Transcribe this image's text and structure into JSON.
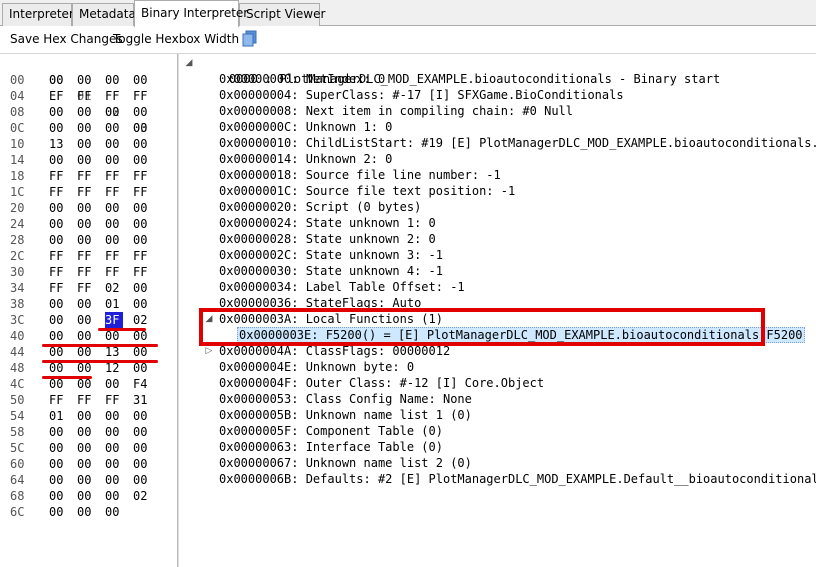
{
  "tabs": [
    "Interpreter",
    "Metadata",
    "Binary Interpreter",
    "Script Viewer"
  ],
  "active_tab": "Binary Interpreter",
  "toolbar": {
    "save_label": "Save Hex Changes",
    "toggle_label": "Toggle Hexbox Width",
    "copy_icon": "copy-icon"
  },
  "hex": {
    "column_headers": [
      "00",
      "01",
      "02",
      "03"
    ],
    "rows": [
      {
        "offset": "00",
        "bytes": [
          "00",
          "00",
          "00",
          "00"
        ]
      },
      {
        "offset": "04",
        "bytes": [
          "EF",
          "FF",
          "FF",
          "FF"
        ]
      },
      {
        "offset": "08",
        "bytes": [
          "00",
          "00",
          "00",
          "00"
        ]
      },
      {
        "offset": "0C",
        "bytes": [
          "00",
          "00",
          "00",
          "00"
        ]
      },
      {
        "offset": "10",
        "bytes": [
          "13",
          "00",
          "00",
          "00"
        ]
      },
      {
        "offset": "14",
        "bytes": [
          "00",
          "00",
          "00",
          "00"
        ]
      },
      {
        "offset": "18",
        "bytes": [
          "FF",
          "FF",
          "FF",
          "FF"
        ]
      },
      {
        "offset": "1C",
        "bytes": [
          "FF",
          "FF",
          "FF",
          "FF"
        ]
      },
      {
        "offset": "20",
        "bytes": [
          "00",
          "00",
          "00",
          "00"
        ]
      },
      {
        "offset": "24",
        "bytes": [
          "00",
          "00",
          "00",
          "00"
        ]
      },
      {
        "offset": "28",
        "bytes": [
          "00",
          "00",
          "00",
          "00"
        ]
      },
      {
        "offset": "2C",
        "bytes": [
          "FF",
          "FF",
          "FF",
          "FF"
        ]
      },
      {
        "offset": "30",
        "bytes": [
          "FF",
          "FF",
          "FF",
          "FF"
        ]
      },
      {
        "offset": "34",
        "bytes": [
          "FF",
          "FF",
          "02",
          "00"
        ]
      },
      {
        "offset": "38",
        "bytes": [
          "00",
          "00",
          "01",
          "00"
        ]
      },
      {
        "offset": "3C",
        "bytes": [
          "00",
          "00",
          "3F",
          "02"
        ]
      },
      {
        "offset": "40",
        "bytes": [
          "00",
          "00",
          "00",
          "00"
        ]
      },
      {
        "offset": "44",
        "bytes": [
          "00",
          "00",
          "13",
          "00"
        ]
      },
      {
        "offset": "48",
        "bytes": [
          "00",
          "00",
          "12",
          "00"
        ]
      },
      {
        "offset": "4C",
        "bytes": [
          "00",
          "00",
          "00",
          "F4"
        ]
      },
      {
        "offset": "50",
        "bytes": [
          "FF",
          "FF",
          "FF",
          "31"
        ]
      },
      {
        "offset": "54",
        "bytes": [
          "01",
          "00",
          "00",
          "00"
        ]
      },
      {
        "offset": "58",
        "bytes": [
          "00",
          "00",
          "00",
          "00"
        ]
      },
      {
        "offset": "5C",
        "bytes": [
          "00",
          "00",
          "00",
          "00"
        ]
      },
      {
        "offset": "60",
        "bytes": [
          "00",
          "00",
          "00",
          "00"
        ]
      },
      {
        "offset": "64",
        "bytes": [
          "00",
          "00",
          "00",
          "00"
        ]
      },
      {
        "offset": "68",
        "bytes": [
          "00",
          "00",
          "00",
          "02"
        ]
      },
      {
        "offset": "6C",
        "bytes": [
          "00",
          "00",
          "00"
        ]
      }
    ],
    "selected_byte": {
      "row": 15,
      "col": 2
    }
  },
  "tree": {
    "root": "0000 : PlotManagerDLC_MOD_EXAMPLE.bioautoconditionals - Binary start",
    "items": [
      "0x00000000: NetIndex: 0",
      "0x00000004: SuperClass: #-17 [I] SFXGame.BioConditionals",
      "0x00000008: Next item in compiling chain: #0 Null",
      "0x0000000C: Unknown 1: 0",
      "0x00000010: ChildListStart: #19 [E] PlotManagerDLC_MOD_EXAMPLE.bioautoconditionals.F5200",
      "0x00000014: Unknown 2: 0",
      "0x00000018: Source file line number: -1",
      "0x0000001C: Source file text position: -1",
      "0x00000020: Script (0 bytes)",
      "0x00000024: State unknown 1: 0",
      "0x00000028: State unknown 2: 0",
      "0x0000002C: State unknown 3: -1",
      "0x00000030: State unknown 4: -1",
      "0x00000034: Label Table Offset: -1",
      "0x00000036: StateFlags: Auto",
      "0x0000003A: Local Functions (1)",
      "0x0000003E: F5200() = [E] PlotManagerDLC_MOD_EXAMPLE.bioautoconditionals.F5200",
      "0x0000004A: ClassFlags: 00000012",
      "0x0000004E: Unknown byte: 0",
      "0x0000004F: Outer Class: #-12 [I] Core.Object",
      "0x00000053: Class Config Name: None",
      "0x0000005B: Unknown name list 1 (0)",
      "0x0000005F: Component Table (0)",
      "0x00000063: Interface Table (0)",
      "0x00000067: Unknown name list 2 (0)",
      "0x0000006B: Defaults: #2 [E] PlotManagerDLC_MOD_EXAMPLE.Default__bioautoconditionals"
    ]
  },
  "colors": {
    "annotation": "#e00000",
    "hex_selection": "#1f1fd7",
    "tree_selection": "#cde8ff"
  }
}
